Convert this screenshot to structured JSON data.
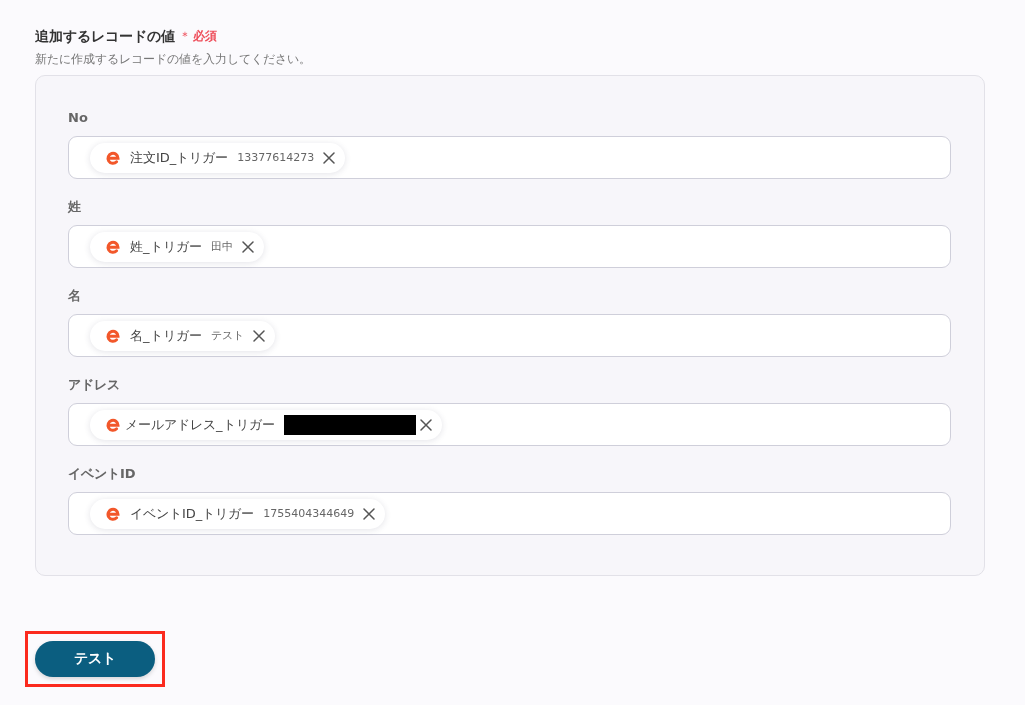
{
  "section": {
    "title": "追加するレコードの値",
    "required_mark": "＊",
    "required_label": "必須",
    "description": "新たに作成するレコードの値を入力してください。"
  },
  "fields": [
    {
      "label": "No",
      "token": {
        "name": "注文ID_トリガー",
        "value": "13377614273",
        "redacted": false
      }
    },
    {
      "label": "姓",
      "token": {
        "name": "姓_トリガー",
        "value": "田中",
        "redacted": false
      }
    },
    {
      "label": "名",
      "token": {
        "name": "名_トリガー",
        "value": "テスト",
        "redacted": false
      }
    },
    {
      "label": "アドレス",
      "token": {
        "name": "メールアドレス_トリガー",
        "redacted": true
      }
    },
    {
      "label": "イベントID",
      "token": {
        "name": "イベントID_トリガー",
        "value": "1755404344649",
        "redacted": false
      }
    }
  ],
  "test_button": {
    "label": "テスト",
    "highlighted": true
  }
}
